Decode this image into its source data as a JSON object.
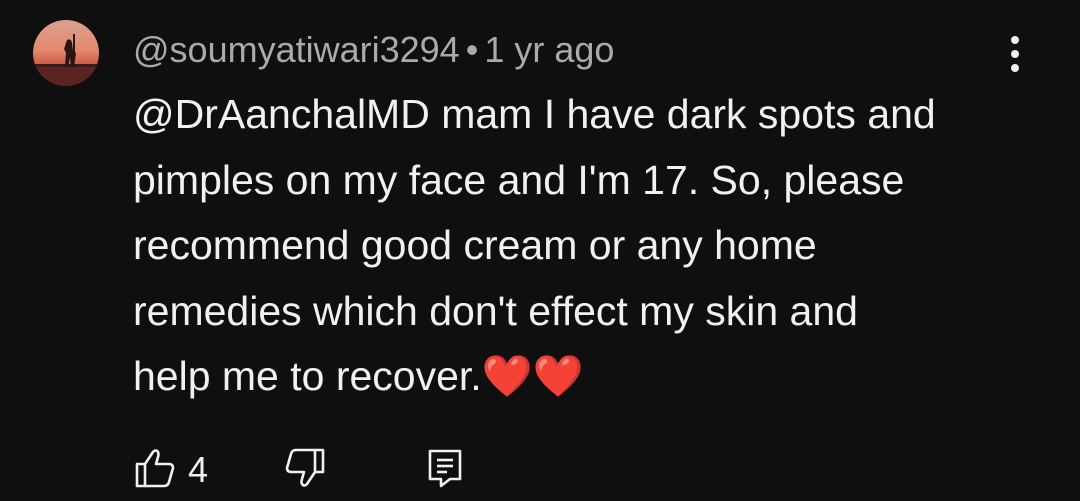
{
  "comment": {
    "author_handle": "@soumyatiwari3294",
    "separator": "•",
    "timestamp": "1 yr ago",
    "text": "@DrAanchalMD mam I have dark spots and\npimples on my face and I'm 17. So, please\nrecommend good cream or any home\nremedies which don't effect my skin and\nhelp me to recover.❤️❤️",
    "like_count": "4"
  },
  "icons": {
    "avatar": "avatar-photo",
    "more": "more-vertical-icon",
    "like": "thumbs-up-icon",
    "dislike": "thumbs-down-icon",
    "reply": "reply-comment-icon"
  },
  "colors": {
    "background": "#0f0f0f",
    "primary_text": "#f1f1f1",
    "secondary_text": "#aaaaaa"
  }
}
